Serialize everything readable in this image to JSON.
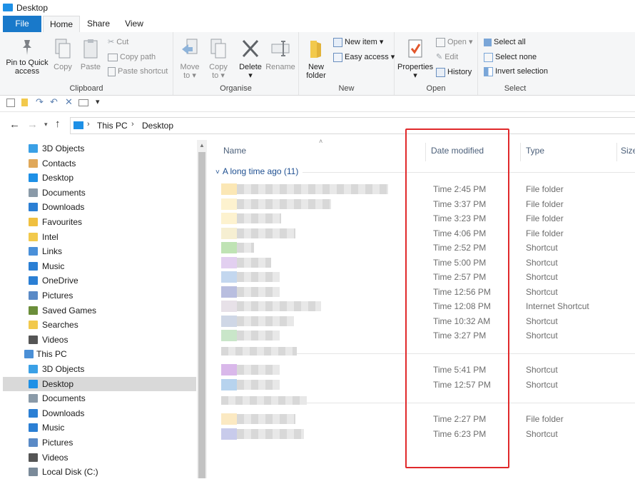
{
  "window": {
    "title": "Desktop"
  },
  "tabs": {
    "file": "File",
    "home": "Home",
    "share": "Share",
    "view": "View"
  },
  "ribbon": {
    "clipboard": {
      "label": "Clipboard",
      "pin": "Pin to Quick access",
      "copy": "Copy",
      "paste": "Paste",
      "cut": "Cut",
      "copy_path": "Copy path",
      "paste_shortcut": "Paste shortcut"
    },
    "organise": {
      "label": "Organise",
      "move_to": "Move to",
      "copy_to": "Copy to",
      "delete": "Delete",
      "rename": "Rename"
    },
    "new": {
      "label": "New",
      "new_folder": "New folder",
      "new_item": "New item",
      "easy_access": "Easy access"
    },
    "open": {
      "label": "Open",
      "properties": "Properties",
      "open": "Open",
      "edit": "Edit",
      "history": "History"
    },
    "select": {
      "label": "Select",
      "select_all": "Select all",
      "select_none": "Select none",
      "invert": "Invert selection"
    }
  },
  "address": {
    "crumbs": [
      "This PC",
      "Desktop"
    ]
  },
  "nav": {
    "items": [
      {
        "label": "3D Objects",
        "icon": "cube-icon",
        "color": "#3aa0e6"
      },
      {
        "label": "Contacts",
        "icon": "contacts-icon",
        "color": "#e0a85a"
      },
      {
        "label": "Desktop",
        "icon": "desktop-icon",
        "color": "#1e90e6"
      },
      {
        "label": "Documents",
        "icon": "document-icon",
        "color": "#8a9aa8"
      },
      {
        "label": "Downloads",
        "icon": "download-icon",
        "color": "#2b7fd4"
      },
      {
        "label": "Favourites",
        "icon": "star-folder-icon",
        "color": "#f0c040"
      },
      {
        "label": "Intel",
        "icon": "folder-icon",
        "color": "#f2c94c"
      },
      {
        "label": "Links",
        "icon": "link-folder-icon",
        "color": "#4a90d9"
      },
      {
        "label": "Music",
        "icon": "music-icon",
        "color": "#2b7fd4"
      },
      {
        "label": "OneDrive",
        "icon": "cloud-folder-icon",
        "color": "#2b7fd4"
      },
      {
        "label": "Pictures",
        "icon": "picture-icon",
        "color": "#5a8ac6"
      },
      {
        "label": "Saved Games",
        "icon": "games-icon",
        "color": "#6b8e3a"
      },
      {
        "label": "Searches",
        "icon": "search-folder-icon",
        "color": "#f2c94c"
      },
      {
        "label": "Videos",
        "icon": "video-icon",
        "color": "#555555"
      }
    ],
    "this_pc": "This PC",
    "pc_items": [
      {
        "label": "3D Objects",
        "icon": "cube-icon",
        "color": "#3aa0e6"
      },
      {
        "label": "Desktop",
        "icon": "desktop-icon",
        "color": "#1e90e6"
      },
      {
        "label": "Documents",
        "icon": "document-icon",
        "color": "#8a9aa8"
      },
      {
        "label": "Downloads",
        "icon": "download-icon",
        "color": "#2b7fd4"
      },
      {
        "label": "Music",
        "icon": "music-icon",
        "color": "#2b7fd4"
      },
      {
        "label": "Pictures",
        "icon": "picture-icon",
        "color": "#5a8ac6"
      },
      {
        "label": "Videos",
        "icon": "video-icon",
        "color": "#555555"
      },
      {
        "label": "Local Disk (C:)",
        "icon": "drive-icon",
        "color": "#7a8a99"
      }
    ]
  },
  "columns": {
    "name": "Name",
    "date": "Date modified",
    "type": "Type",
    "size": "Size"
  },
  "group": {
    "label": "A long time ago (11)"
  },
  "rows": [
    {
      "date": "Time 2:45 PM",
      "type": "File folder",
      "swatch": "#fbe7b5"
    },
    {
      "date": "Time 3:37 PM",
      "type": "File folder",
      "swatch": "#fdf2cf"
    },
    {
      "date": "Time 3:23 PM",
      "type": "File folder",
      "swatch": "#fdf2cf"
    },
    {
      "date": "Time 4:06 PM",
      "type": "File folder",
      "swatch": "#f6efd2"
    },
    {
      "date": "Time 2:52 PM",
      "type": "Shortcut",
      "swatch": "#bfe3b4"
    },
    {
      "date": "Time 5:00 PM",
      "type": "Shortcut",
      "swatch": "#e2cff0"
    },
    {
      "date": "Time 2:57 PM",
      "type": "Shortcut",
      "swatch": "#c3d7ef"
    },
    {
      "date": "Time 12:56 PM",
      "type": "Shortcut",
      "swatch": "#b9bedf"
    },
    {
      "date": "Time 12:08 PM",
      "type": "Internet Shortcut",
      "swatch": "#e7e1e8"
    },
    {
      "date": "Time 10:32 AM",
      "type": "Shortcut",
      "swatch": "#cfd7e6"
    },
    {
      "date": "Time 3:27 PM",
      "type": "Shortcut",
      "swatch": "#c9e6c9"
    },
    {
      "date": "Time 5:41 PM",
      "type": "Shortcut",
      "swatch": "#d9b8ea"
    },
    {
      "date": "Time 12:57 PM",
      "type": "Shortcut",
      "swatch": "#b7d3ee"
    },
    {
      "date": "Time 2:27 PM",
      "type": "File folder",
      "swatch": "#fbe9c2"
    },
    {
      "date": "Time 6:23 PM",
      "type": "Shortcut",
      "swatch": "#c8cbeb"
    }
  ],
  "highlight_color": "#e0292b"
}
